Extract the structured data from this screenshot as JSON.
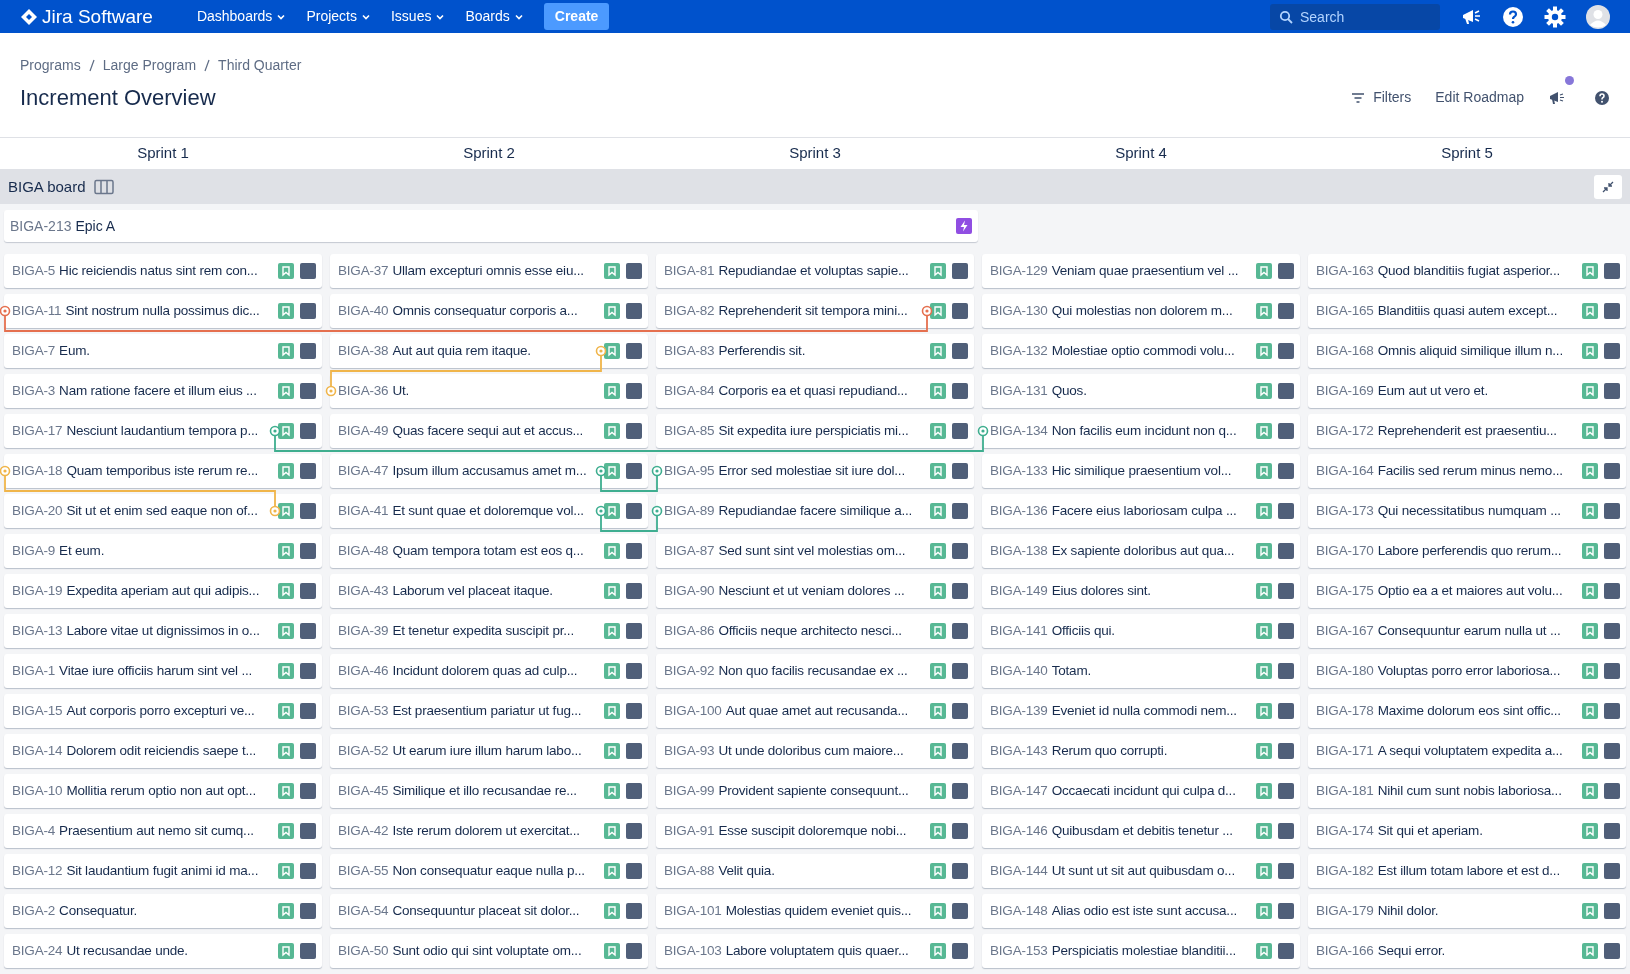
{
  "nav": {
    "product": "Jira Software",
    "menus": [
      {
        "label": "Dashboards"
      },
      {
        "label": "Projects"
      },
      {
        "label": "Issues"
      },
      {
        "label": "Boards"
      }
    ],
    "create": "Create",
    "search": {
      "placeholder": "Search"
    }
  },
  "breadcrumbs": [
    "Programs",
    "Large Program",
    "Third Quarter"
  ],
  "title": "Increment Overview",
  "actions": {
    "filters": "Filters",
    "edit": "Edit Roadmap",
    "announcement_unread": true
  },
  "board": {
    "name": "BIGA board",
    "epic": {
      "key": "BIGA-213",
      "title": "Epic A"
    }
  },
  "sprints": [
    {
      "name": "Sprint 1",
      "cards": [
        {
          "key": "BIGA-5",
          "summary": "Hic reiciendis natus sint rem con..."
        },
        {
          "key": "BIGA-11",
          "summary": "Sint nostrum nulla possimus dic...",
          "link": {
            "outgoing": false,
            "color": "#e5704f"
          }
        },
        {
          "key": "BIGA-7",
          "summary": "Eum."
        },
        {
          "key": "BIGA-3",
          "summary": "Nam ratione facere et illum eius ..."
        },
        {
          "key": "BIGA-17",
          "summary": "Nesciunt laudantium tempora p...",
          "link": {
            "outgoing": true,
            "color": "#3fae8f"
          }
        },
        {
          "key": "BIGA-18",
          "summary": "Quam temporibus iste rerum re...",
          "link": {
            "outgoing": false,
            "color": "#f0b54a"
          }
        },
        {
          "key": "BIGA-20",
          "summary": "Sit ut et enim sed eaque non of...",
          "link": {
            "outgoing": true,
            "color": "#f0b54a"
          }
        },
        {
          "key": "BIGA-9",
          "summary": "Et eum."
        },
        {
          "key": "BIGA-19",
          "summary": "Expedita aperiam aut qui adipis..."
        },
        {
          "key": "BIGA-13",
          "summary": "Labore vitae ut dignissimos in o..."
        },
        {
          "key": "BIGA-1",
          "summary": "Vitae iure officiis harum sint vel ..."
        },
        {
          "key": "BIGA-15",
          "summary": "Aut corporis porro excepturi ve..."
        },
        {
          "key": "BIGA-14",
          "summary": "Dolorem odit reiciendis saepe t..."
        },
        {
          "key": "BIGA-10",
          "summary": "Mollitia rerum optio non aut opt..."
        },
        {
          "key": "BIGA-4",
          "summary": "Praesentium aut nemo sit cumq..."
        },
        {
          "key": "BIGA-12",
          "summary": "Sit laudantium fugit animi id ma..."
        },
        {
          "key": "BIGA-2",
          "summary": "Consequatur."
        },
        {
          "key": "BIGA-24",
          "summary": "Ut recusandae unde."
        }
      ]
    },
    {
      "name": "Sprint 2",
      "cards": [
        {
          "key": "BIGA-37",
          "summary": "Ullam excepturi omnis esse eiu..."
        },
        {
          "key": "BIGA-40",
          "summary": "Omnis consequatur corporis a..."
        },
        {
          "key": "BIGA-38",
          "summary": "Aut aut quia rem itaque.",
          "link": {
            "outgoing": true,
            "color": "#f0b54b"
          }
        },
        {
          "key": "BIGA-36",
          "summary": "Ut.",
          "link": {
            "outgoing": false,
            "color": "#f0b54b"
          }
        },
        {
          "key": "BIGA-49",
          "summary": "Quas facere sequi aut et accus..."
        },
        {
          "key": "BIGA-47",
          "summary": "Ipsum illum accusamus amet m...",
          "link": {
            "outgoing": true,
            "color": "#3fae90"
          }
        },
        {
          "key": "BIGA-41",
          "summary": "Et sunt quae et doloremque vol...",
          "link": {
            "outgoing": true,
            "color": "#3fae91"
          }
        },
        {
          "key": "BIGA-48",
          "summary": "Quam tempora totam est eos q..."
        },
        {
          "key": "BIGA-43",
          "summary": "Laborum vel placeat itaque."
        },
        {
          "key": "BIGA-39",
          "summary": "Et tenetur expedita suscipit pr..."
        },
        {
          "key": "BIGA-46",
          "summary": "Incidunt dolorem quas ad culp..."
        },
        {
          "key": "BIGA-53",
          "summary": "Est praesentium pariatur ut fug..."
        },
        {
          "key": "BIGA-52",
          "summary": "Ut earum iure illum harum labo..."
        },
        {
          "key": "BIGA-45",
          "summary": "Similique et illo recusandae re..."
        },
        {
          "key": "BIGA-42",
          "summary": "Iste rerum dolorem ut exercitat..."
        },
        {
          "key": "BIGA-55",
          "summary": "Non consequatur eaque nulla p..."
        },
        {
          "key": "BIGA-54",
          "summary": "Consequuntur placeat sit dolor..."
        },
        {
          "key": "BIGA-50",
          "summary": "Sunt odio qui sint voluptate om..."
        }
      ]
    },
    {
      "name": "Sprint 3",
      "cards": [
        {
          "key": "BIGA-81",
          "summary": "Repudiandae et voluptas sapie..."
        },
        {
          "key": "BIGA-82",
          "summary": "Reprehenderit sit tempora mini...",
          "link": {
            "outgoing": true,
            "color": "#e5704f"
          }
        },
        {
          "key": "BIGA-83",
          "summary": "Perferendis sit."
        },
        {
          "key": "BIGA-84",
          "summary": "Corporis ea et quasi repudiand..."
        },
        {
          "key": "BIGA-85",
          "summary": "Sit expedita iure perspiciatis mi..."
        },
        {
          "key": "BIGA-95",
          "summary": "Error sed molestiae sit iure dol...",
          "link": {
            "outgoing": false,
            "color": "#3fae90"
          }
        },
        {
          "key": "BIGA-89",
          "summary": "Repudiandae facere similique a...",
          "link": {
            "outgoing": false,
            "color": "#3fae91"
          }
        },
        {
          "key": "BIGA-87",
          "summary": "Sed sunt sint vel molestias om..."
        },
        {
          "key": "BIGA-90",
          "summary": "Nesciunt et ut veniam dolores ..."
        },
        {
          "key": "BIGA-86",
          "summary": "Officiis neque architecto nesci..."
        },
        {
          "key": "BIGA-92",
          "summary": "Non quo facilis recusandae ex ..."
        },
        {
          "key": "BIGA-100",
          "summary": "Aut quae amet aut recusanda..."
        },
        {
          "key": "BIGA-93",
          "summary": "Ut unde doloribus cum maiore..."
        },
        {
          "key": "BIGA-99",
          "summary": "Provident sapiente consequunt..."
        },
        {
          "key": "BIGA-91",
          "summary": "Esse suscipit doloremque nobi..."
        },
        {
          "key": "BIGA-88",
          "summary": "Velit quia."
        },
        {
          "key": "BIGA-101",
          "summary": "Molestias quidem eveniet quis..."
        },
        {
          "key": "BIGA-103",
          "summary": "Labore voluptatem quis quaer..."
        }
      ]
    },
    {
      "name": "Sprint 4",
      "cards": [
        {
          "key": "BIGA-129",
          "summary": "Veniam quae praesentium vel ..."
        },
        {
          "key": "BIGA-130",
          "summary": "Qui molestias non dolorem m..."
        },
        {
          "key": "BIGA-132",
          "summary": "Molestiae optio commodi volu..."
        },
        {
          "key": "BIGA-131",
          "summary": "Quos."
        },
        {
          "key": "BIGA-134",
          "summary": "Non facilis eum incidunt non q...",
          "link": {
            "outgoing": false,
            "color": "#3fae8f"
          }
        },
        {
          "key": "BIGA-133",
          "summary": "Hic similique praesentium vol..."
        },
        {
          "key": "BIGA-136",
          "summary": "Facere eius laboriosam culpa ..."
        },
        {
          "key": "BIGA-138",
          "summary": "Ex sapiente doloribus aut qua..."
        },
        {
          "key": "BIGA-149",
          "summary": "Eius dolores sint."
        },
        {
          "key": "BIGA-141",
          "summary": "Officiis qui."
        },
        {
          "key": "BIGA-140",
          "summary": "Totam."
        },
        {
          "key": "BIGA-139",
          "summary": "Eveniet id nulla commodi nem..."
        },
        {
          "key": "BIGA-143",
          "summary": "Rerum quo corrupti."
        },
        {
          "key": "BIGA-147",
          "summary": "Occaecati incidunt qui culpa d..."
        },
        {
          "key": "BIGA-146",
          "summary": "Quibusdam et debitis tenetur ..."
        },
        {
          "key": "BIGA-144",
          "summary": "Ut sunt ut sit aut quibusdam o..."
        },
        {
          "key": "BIGA-148",
          "summary": "Alias odio est iste sunt accusa..."
        },
        {
          "key": "BIGA-153",
          "summary": "Perspiciatis molestiae blanditii..."
        }
      ]
    },
    {
      "name": "Sprint 5",
      "cards": [
        {
          "key": "BIGA-163",
          "summary": "Quod blanditiis fugiat asperior..."
        },
        {
          "key": "BIGA-165",
          "summary": "Blanditiis quasi autem except..."
        },
        {
          "key": "BIGA-168",
          "summary": "Omnis aliquid similique illum n..."
        },
        {
          "key": "BIGA-169",
          "summary": "Eum aut ut vero et."
        },
        {
          "key": "BIGA-172",
          "summary": "Reprehenderit est praesentiu..."
        },
        {
          "key": "BIGA-164",
          "summary": "Facilis sed rerum minus nemo..."
        },
        {
          "key": "BIGA-173",
          "summary": "Qui necessitatibus numquam ..."
        },
        {
          "key": "BIGA-170",
          "summary": "Labore perferendis quo rerum..."
        },
        {
          "key": "BIGA-175",
          "summary": "Optio ea a et maiores aut volu..."
        },
        {
          "key": "BIGA-167",
          "summary": "Consequuntur earum nulla ut ..."
        },
        {
          "key": "BIGA-180",
          "summary": "Voluptas porro error laboriosa..."
        },
        {
          "key": "BIGA-178",
          "summary": "Maxime dolorum eos sint offic..."
        },
        {
          "key": "BIGA-171",
          "summary": "A sequi voluptatem expedita a..."
        },
        {
          "key": "BIGA-181",
          "summary": "Nihil cum sunt nobis laboriosa..."
        },
        {
          "key": "BIGA-174",
          "summary": "Sit qui et aperiam."
        },
        {
          "key": "BIGA-182",
          "summary": "Est illum totam labore et est d..."
        },
        {
          "key": "BIGA-179",
          "summary": "Nihil dolor."
        },
        {
          "key": "BIGA-166",
          "summary": "Sequi error."
        }
      ]
    }
  ]
}
